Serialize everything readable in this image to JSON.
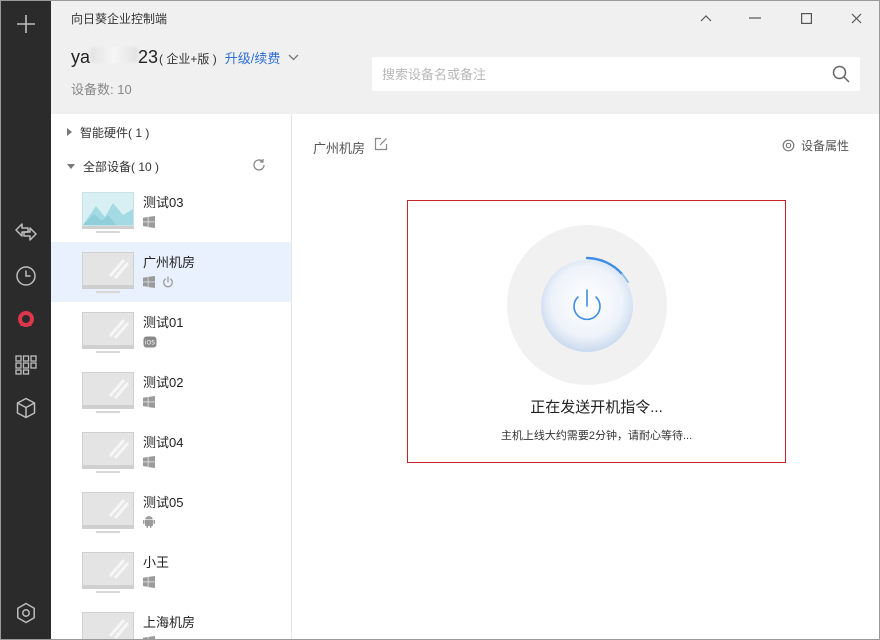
{
  "window": {
    "title": "向日葵企业控制端"
  },
  "account": {
    "name_prefix": "ya",
    "name_suffix": "23",
    "edition": "( 企业+版 )",
    "upgrade_label": "升级/续费",
    "device_count_label": "设备数: 10"
  },
  "search": {
    "placeholder": "搜索设备名或备注"
  },
  "groups": {
    "smart_hardware": "智能硬件( 1 )",
    "all_devices": "全部设备( 10 )"
  },
  "devices": [
    {
      "name": "测试03",
      "os": "windows-icon",
      "thumb": "landscape"
    },
    {
      "name": "广州机房",
      "os": "windows-icon",
      "thumb": "monitor",
      "selected": true,
      "power": true
    },
    {
      "name": "测试01",
      "os": "ios-icon",
      "thumb": "monitor"
    },
    {
      "name": "测试02",
      "os": "windows-icon",
      "thumb": "monitor"
    },
    {
      "name": "测试04",
      "os": "windows-icon",
      "thumb": "monitor"
    },
    {
      "name": "测试05",
      "os": "android-icon",
      "thumb": "monitor"
    },
    {
      "name": "小王",
      "os": "windows-icon",
      "thumb": "monitor"
    },
    {
      "name": "上海机房",
      "os": "windows-icon",
      "thumb": "monitor"
    }
  ],
  "detail": {
    "title": "广州机房",
    "properties_label": "设备属性",
    "boot_message": "正在发送开机指令...",
    "boot_hint": "主机上线大约需要2分钟，请耐心等待..."
  },
  "colors": {
    "rail_bg": "#2b2b2b",
    "accent_blue": "#2f6fd6",
    "brand_red": "#e0364b",
    "selected_bg": "#e8f1fd",
    "boot_border": "#c8232c"
  }
}
